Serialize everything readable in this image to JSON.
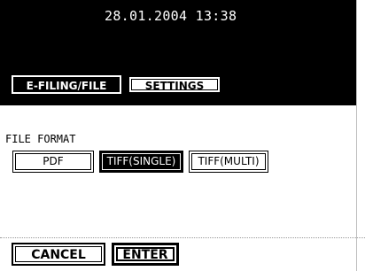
{
  "status_bar": {
    "datetime": "28.01.2004 13:38"
  },
  "tabs": [
    {
      "label": "E-FILING/FILE",
      "active": true
    },
    {
      "label": "SETTINGS",
      "active": false
    }
  ],
  "file_format": {
    "label": "FILE FORMAT",
    "options": [
      {
        "label": "PDF",
        "selected": false
      },
      {
        "label": "TIFF(SINGLE)",
        "selected": true
      },
      {
        "label": "TIFF(MULTI)",
        "selected": false
      }
    ]
  },
  "actions": {
    "cancel": "CANCEL",
    "enter": "ENTER"
  }
}
